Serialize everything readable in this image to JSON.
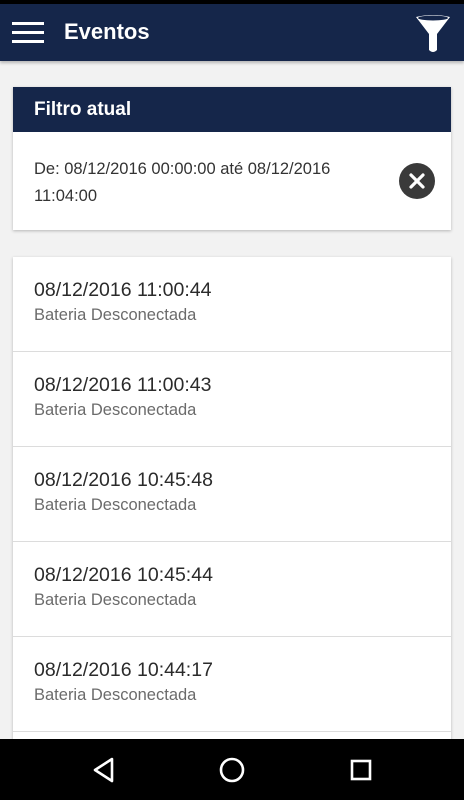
{
  "appbar": {
    "title": "Eventos",
    "menu_icon": "hamburger-menu-icon",
    "filter_icon": "funnel-filter-icon",
    "color": "#15264a"
  },
  "filter": {
    "header": "Filtro atual",
    "text": "De: 08/12/2016 00:00:00 até 08/12/2016 11:04:00",
    "clear_icon": "close-circle-icon"
  },
  "events": [
    {
      "time": "08/12/2016 11:00:44",
      "description": "Bateria Desconectada"
    },
    {
      "time": "08/12/2016 11:00:43",
      "description": "Bateria Desconectada"
    },
    {
      "time": "08/12/2016 10:45:48",
      "description": "Bateria Desconectada"
    },
    {
      "time": "08/12/2016 10:45:44",
      "description": "Bateria Desconectada"
    },
    {
      "time": "08/12/2016 10:44:17",
      "description": "Bateria Desconectada"
    }
  ],
  "navbar": {
    "back_icon": "back-triangle-icon",
    "home_icon": "home-circle-icon",
    "recents_icon": "recents-square-icon"
  }
}
